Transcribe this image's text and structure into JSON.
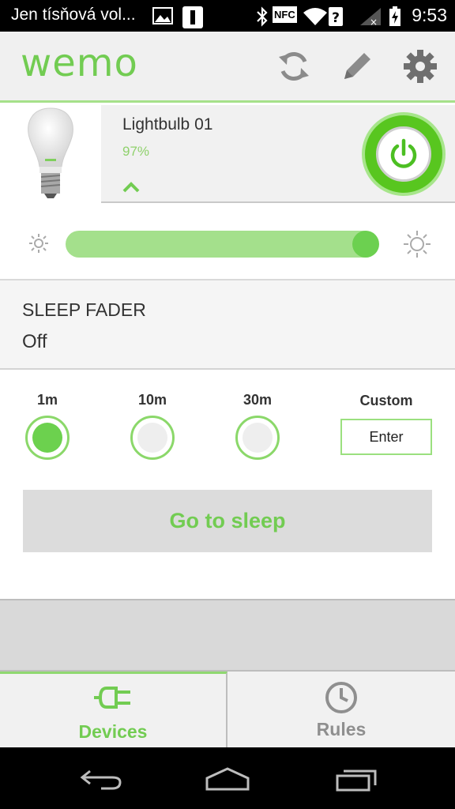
{
  "status_bar": {
    "notification_text": "Jen tísňová vol...",
    "time": "9:53",
    "icons": [
      "image-icon",
      "sim-icon",
      "bluetooth-icon",
      "nfc-icon",
      "wifi-icon",
      "signal-icon",
      "battery-icon"
    ],
    "nfc_label": "NFC"
  },
  "header": {
    "logo": "wemo",
    "icons": [
      "refresh-icon",
      "edit-icon",
      "settings-icon"
    ]
  },
  "device": {
    "name": "Lightbulb 01",
    "level": "97%",
    "power_state": "on",
    "accent_color": "#58c61f"
  },
  "brightness": {
    "value_percent": 97
  },
  "sleep_fader": {
    "title": "SLEEP FADER",
    "value": "Off"
  },
  "timer_options": [
    {
      "label": "1m",
      "selected": true
    },
    {
      "label": "10m",
      "selected": false
    },
    {
      "label": "30m",
      "selected": false
    }
  ],
  "custom": {
    "label": "Custom",
    "input_value": "Enter"
  },
  "sleep_button": {
    "label": "Go to sleep"
  },
  "tabs": [
    {
      "label": "Devices",
      "icon": "plug-icon",
      "active": true
    },
    {
      "label": "Rules",
      "icon": "clock-icon",
      "active": false
    }
  ],
  "nav_bar": {
    "buttons": [
      "back-icon",
      "home-icon",
      "recent-apps-icon"
    ]
  },
  "colors": {
    "brand_green": "#72cc52",
    "light_green": "#a4e08c"
  }
}
